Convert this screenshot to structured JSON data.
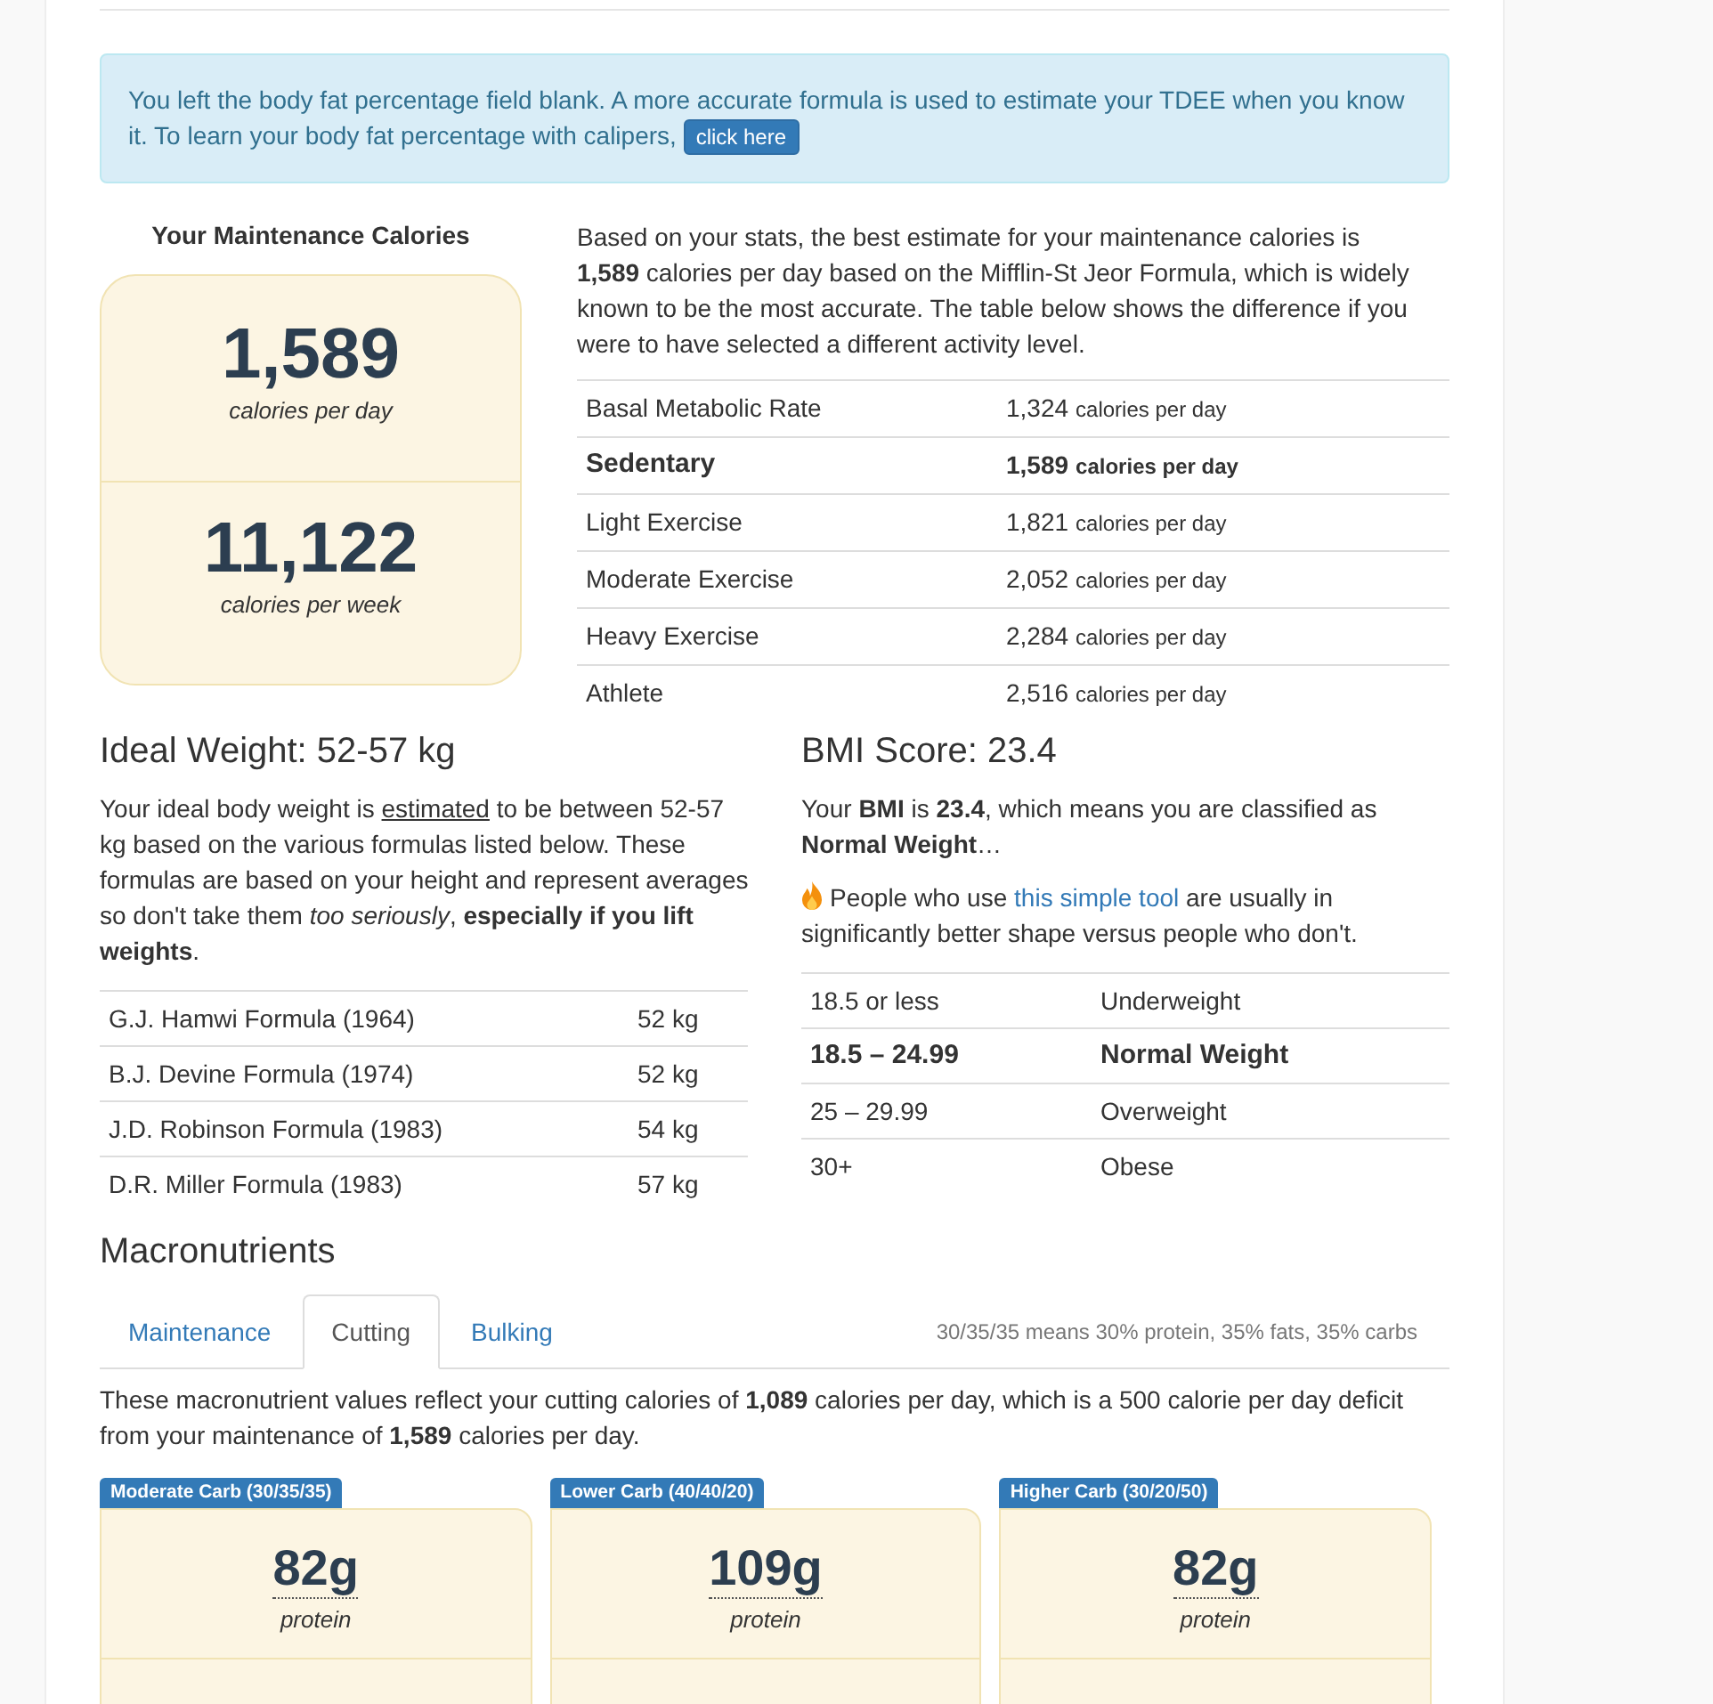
{
  "alert": {
    "text": "You left the body fat percentage field blank. A more accurate formula is used to estimate your TDEE when you know it. To learn your body fat percentage with calipers,",
    "button": "click here"
  },
  "maintenance": {
    "heading": "Your Maintenance Calories",
    "per_day": {
      "value": "1,589",
      "unit": "calories per day"
    },
    "per_week": {
      "value": "11,122",
      "unit": "calories per week"
    },
    "description": "Based on your stats, the best estimate for your maintenance calories is **1,589** calories per day based on the Mifflin-St Jeor Formula, which is widely known to be the most accurate. The table below shows the difference if you were to have selected a different activity level.",
    "activity_levels": [
      {
        "label": "Basal Metabolic Rate",
        "value": "1,324",
        "unit": "calories per day",
        "selected": false
      },
      {
        "label": "Sedentary",
        "value": "1,589",
        "unit": "calories per day",
        "selected": true
      },
      {
        "label": "Light Exercise",
        "value": "1,821",
        "unit": "calories per day",
        "selected": false
      },
      {
        "label": "Moderate Exercise",
        "value": "2,052",
        "unit": "calories per day",
        "selected": false
      },
      {
        "label": "Heavy Exercise",
        "value": "2,284",
        "unit": "calories per day",
        "selected": false
      },
      {
        "label": "Athlete",
        "value": "2,516",
        "unit": "calories per day",
        "selected": false
      }
    ]
  },
  "ideal_weight": {
    "heading": "Ideal Weight: 52-57 kg",
    "description": {
      "before": "Your ideal body weight is ",
      "underlined": "estimated",
      "after": " to be between 52-57 kg based on the various formulas listed below. These formulas are based on your height and represent averages so don't take them *too seriously*, **especially if you lift weights**."
    },
    "formulas": [
      {
        "name": "G.J. Hamwi Formula (1964)",
        "weight": "52 kg"
      },
      {
        "name": "B.J. Devine Formula (1974)",
        "weight": "52 kg"
      },
      {
        "name": "J.D. Robinson Formula (1983)",
        "weight": "54 kg"
      },
      {
        "name": "D.R. Miller Formula (1983)",
        "weight": "57 kg"
      }
    ]
  },
  "bmi": {
    "heading": "BMI Score: 23.4",
    "description": "Your **BMI** is **23.4**, which means you are classified as **Normal Weight**…",
    "promo": {
      "before": "People who use ",
      "link": "this simple tool",
      "after": " are usually in significantly better shape versus people who don't."
    },
    "ranges": [
      {
        "range": "18.5 or less",
        "category": "Underweight",
        "selected": false
      },
      {
        "range": "18.5 – 24.99",
        "category": "Normal Weight",
        "selected": true
      },
      {
        "range": "25 – 29.99",
        "category": "Overweight",
        "selected": false
      },
      {
        "range": "30+",
        "category": "Obese",
        "selected": false
      }
    ]
  },
  "macronutrients": {
    "heading": "Macronutrients",
    "tabs": [
      {
        "label": "Maintenance",
        "selected": false
      },
      {
        "label": "Cutting",
        "selected": true
      },
      {
        "label": "Bulking",
        "selected": false
      }
    ],
    "tab_note": "30/35/35 means 30% protein, 35% fats, 35% carbs",
    "description": "These macronutrient values reflect your cutting calories of **1,089** calories per day, which is a 500 calorie per day deficit from your maintenance of **1,589** calories per day.",
    "plans": [
      {
        "label": "Moderate Carb (30/35/35)",
        "protein": {
          "value": "82g",
          "unit": "protein"
        }
      },
      {
        "label": "Lower Carb (40/40/20)",
        "protein": {
          "value": "109g",
          "unit": "protein"
        }
      },
      {
        "label": "Higher Carb (30/20/50)",
        "protein": {
          "value": "82g",
          "unit": "protein"
        }
      }
    ]
  }
}
